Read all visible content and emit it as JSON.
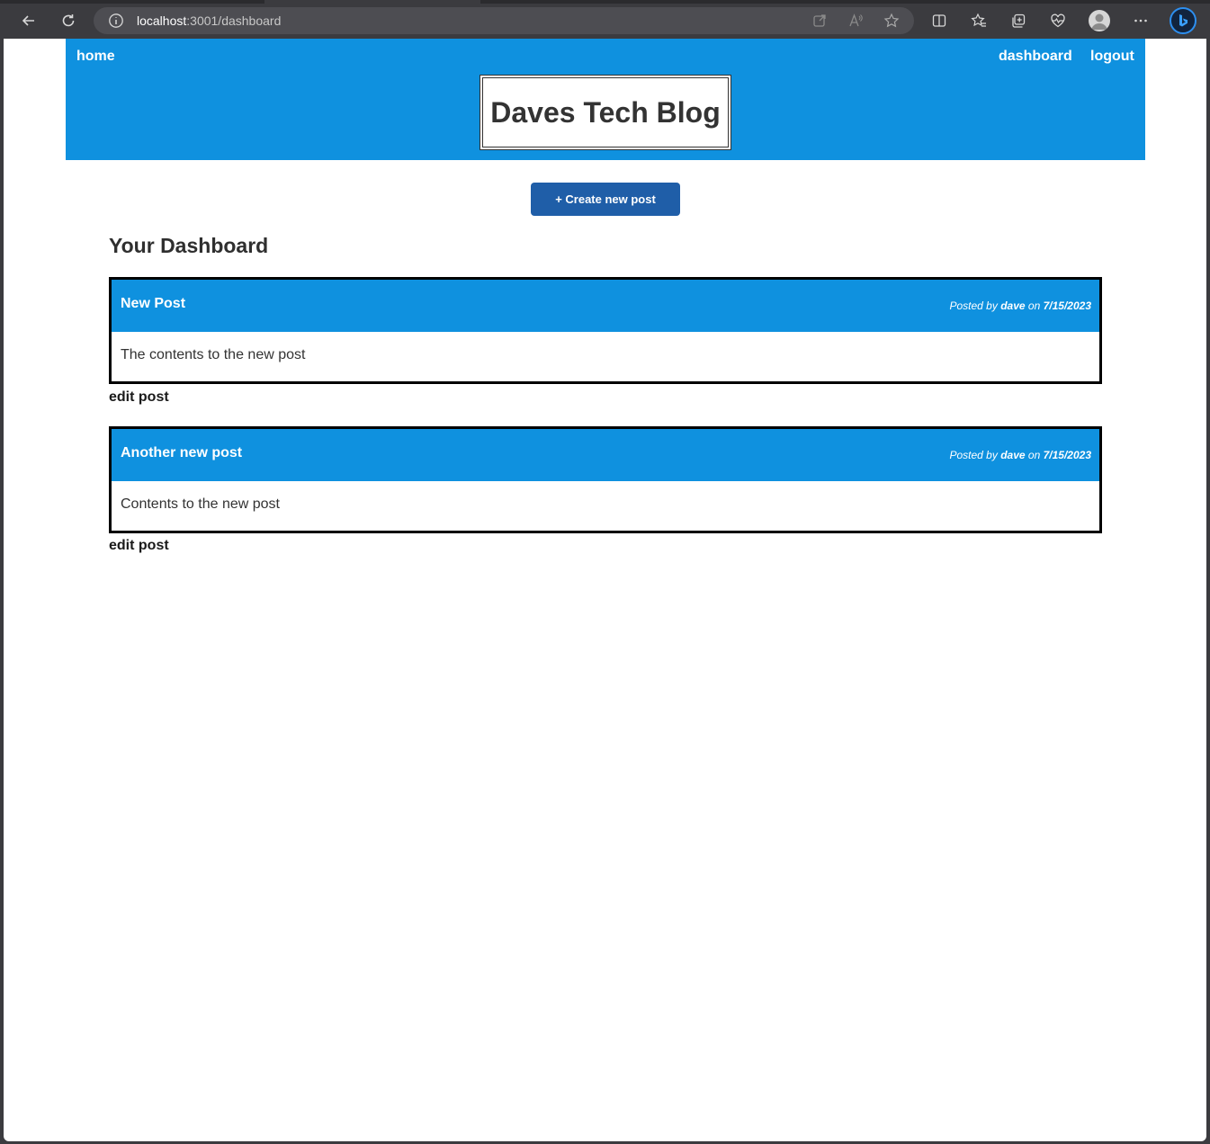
{
  "browser": {
    "url_host": "localhost",
    "url_path": ":3001/dashboard"
  },
  "nav": {
    "home": "home",
    "dashboard": "dashboard",
    "logout": "logout"
  },
  "site": {
    "title": "Daves Tech Blog"
  },
  "actions": {
    "create_post": "+ Create new post"
  },
  "dashboard": {
    "heading": "Your Dashboard"
  },
  "posts": [
    {
      "title": "New Post",
      "posted_by_prefix": "Posted by",
      "author": "dave",
      "on": "on",
      "date": "7/15/2023",
      "content": "The contents to the new post",
      "edit_label": "edit post"
    },
    {
      "title": "Another new post",
      "posted_by_prefix": "Posted by",
      "author": "dave",
      "on": "on",
      "date": "7/15/2023",
      "content": "Contents to the new post",
      "edit_label": "edit post"
    }
  ],
  "colors": {
    "header_blue": "#0f91df",
    "button_blue": "#1f5ea8",
    "browser_chrome": "#3b3b3f"
  }
}
